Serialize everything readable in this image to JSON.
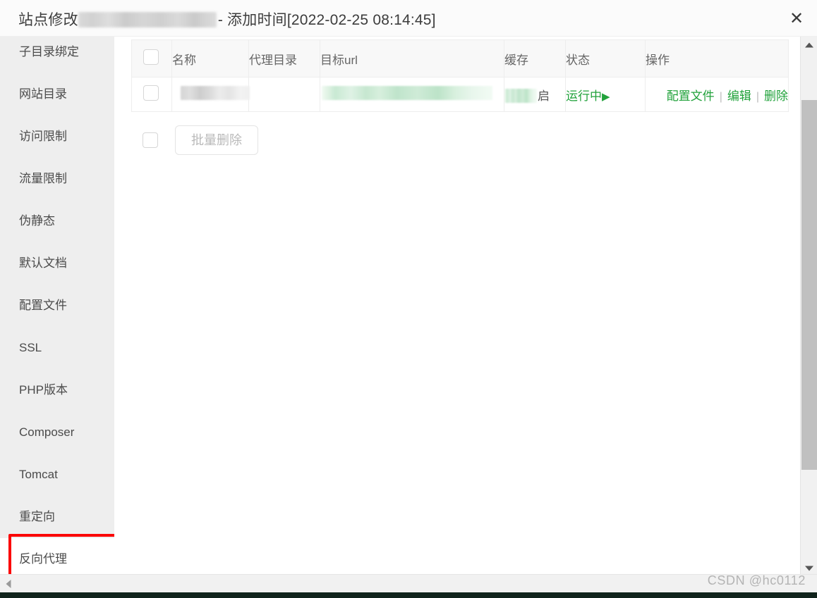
{
  "dialog": {
    "title_prefix": "站点修改",
    "title_redacted": "[redacted-domain]",
    "title_suffix": "- 添加时间[2022-02-25 08:14:45]",
    "close_icon": "close-icon",
    "close_label": "✕"
  },
  "sidebar": {
    "items": [
      {
        "label": "子目录绑定",
        "active": false
      },
      {
        "label": "网站目录",
        "active": false
      },
      {
        "label": "访问限制",
        "active": false
      },
      {
        "label": "流量限制",
        "active": false
      },
      {
        "label": "伪静态",
        "active": false
      },
      {
        "label": "默认文档",
        "active": false
      },
      {
        "label": "配置文件",
        "active": false
      },
      {
        "label": "SSL",
        "active": false
      },
      {
        "label": "PHP版本",
        "active": false
      },
      {
        "label": "Composer",
        "active": false
      },
      {
        "label": "Tomcat",
        "active": false
      },
      {
        "label": "重定向",
        "active": false
      },
      {
        "label": "反向代理",
        "active": true
      }
    ]
  },
  "annotation": {
    "color": "#fb0505",
    "target": "反向代理"
  },
  "table": {
    "columns": [
      {
        "key": "check",
        "label": ""
      },
      {
        "key": "name",
        "label": "名称"
      },
      {
        "key": "dir",
        "label": "代理目录"
      },
      {
        "key": "url",
        "label": "目标url"
      },
      {
        "key": "cache",
        "label": "缓存"
      },
      {
        "key": "status",
        "label": "状态"
      },
      {
        "key": "op",
        "label": "操作"
      }
    ],
    "rows": [
      {
        "name": "[redacted]",
        "dir": "",
        "url": "[redacted-url]",
        "cache": "启",
        "status": "运行中",
        "status_icon": "play-icon",
        "status_glyph": "▶",
        "actions": [
          {
            "label": "配置文件"
          },
          {
            "label": "编辑"
          },
          {
            "label": "删除"
          }
        ],
        "action_separator": "|"
      }
    ]
  },
  "batch": {
    "select_all_name": "select-all-checkbox",
    "delete_label": "批量删除",
    "disabled": true
  },
  "scrollbars": {
    "vertical_up": "▲",
    "vertical_down": "▼",
    "horizontal_left": "◀"
  },
  "watermark": {
    "text": "CSDN @hc0112"
  },
  "colors": {
    "link_green": "#21a23b",
    "annotation_red": "#fb0505",
    "sidebar_bg": "#eeeeee",
    "header_bg": "#f8f8f8"
  }
}
